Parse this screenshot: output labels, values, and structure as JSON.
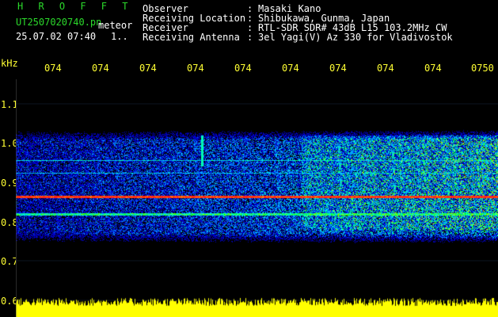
{
  "app": {
    "title": "H R O F F T",
    "file_name": "UT2507020740.pn",
    "event_tag": "meteor",
    "datetime": "25.07.02 07:40",
    "status_text": "1.."
  },
  "header": {
    "rows": [
      {
        "label": "Observer",
        "value": "Masaki Kano"
      },
      {
        "label": "Receiving Location",
        "value": "Shibukawa, Gunma, Japan"
      },
      {
        "label": "Receiver",
        "value": "RTL-SDR SDR# 43dB L15 103.2MHz CW"
      },
      {
        "label": "Receiving Antenna",
        "value": "3el Yagi(V) Az 330 for Vladivostok"
      }
    ],
    "colon": ":"
  },
  "time_axis": {
    "labels": [
      "074",
      "074",
      "074",
      "074",
      "074",
      "074",
      "074",
      "074",
      "074",
      "0750"
    ]
  },
  "freq_axis": {
    "unit": "kHz",
    "labels": [
      "1.1",
      "1.0",
      "0.9",
      "0.8",
      "0.7",
      "0.6"
    ]
  },
  "colors": {
    "label_green": "#2bd92b",
    "label_white": "#ffffff",
    "axis_yellow": "#ffff33",
    "power_bar": "#ffff00",
    "grid": "#3a5a8a",
    "carrier": "#ff2020"
  }
}
